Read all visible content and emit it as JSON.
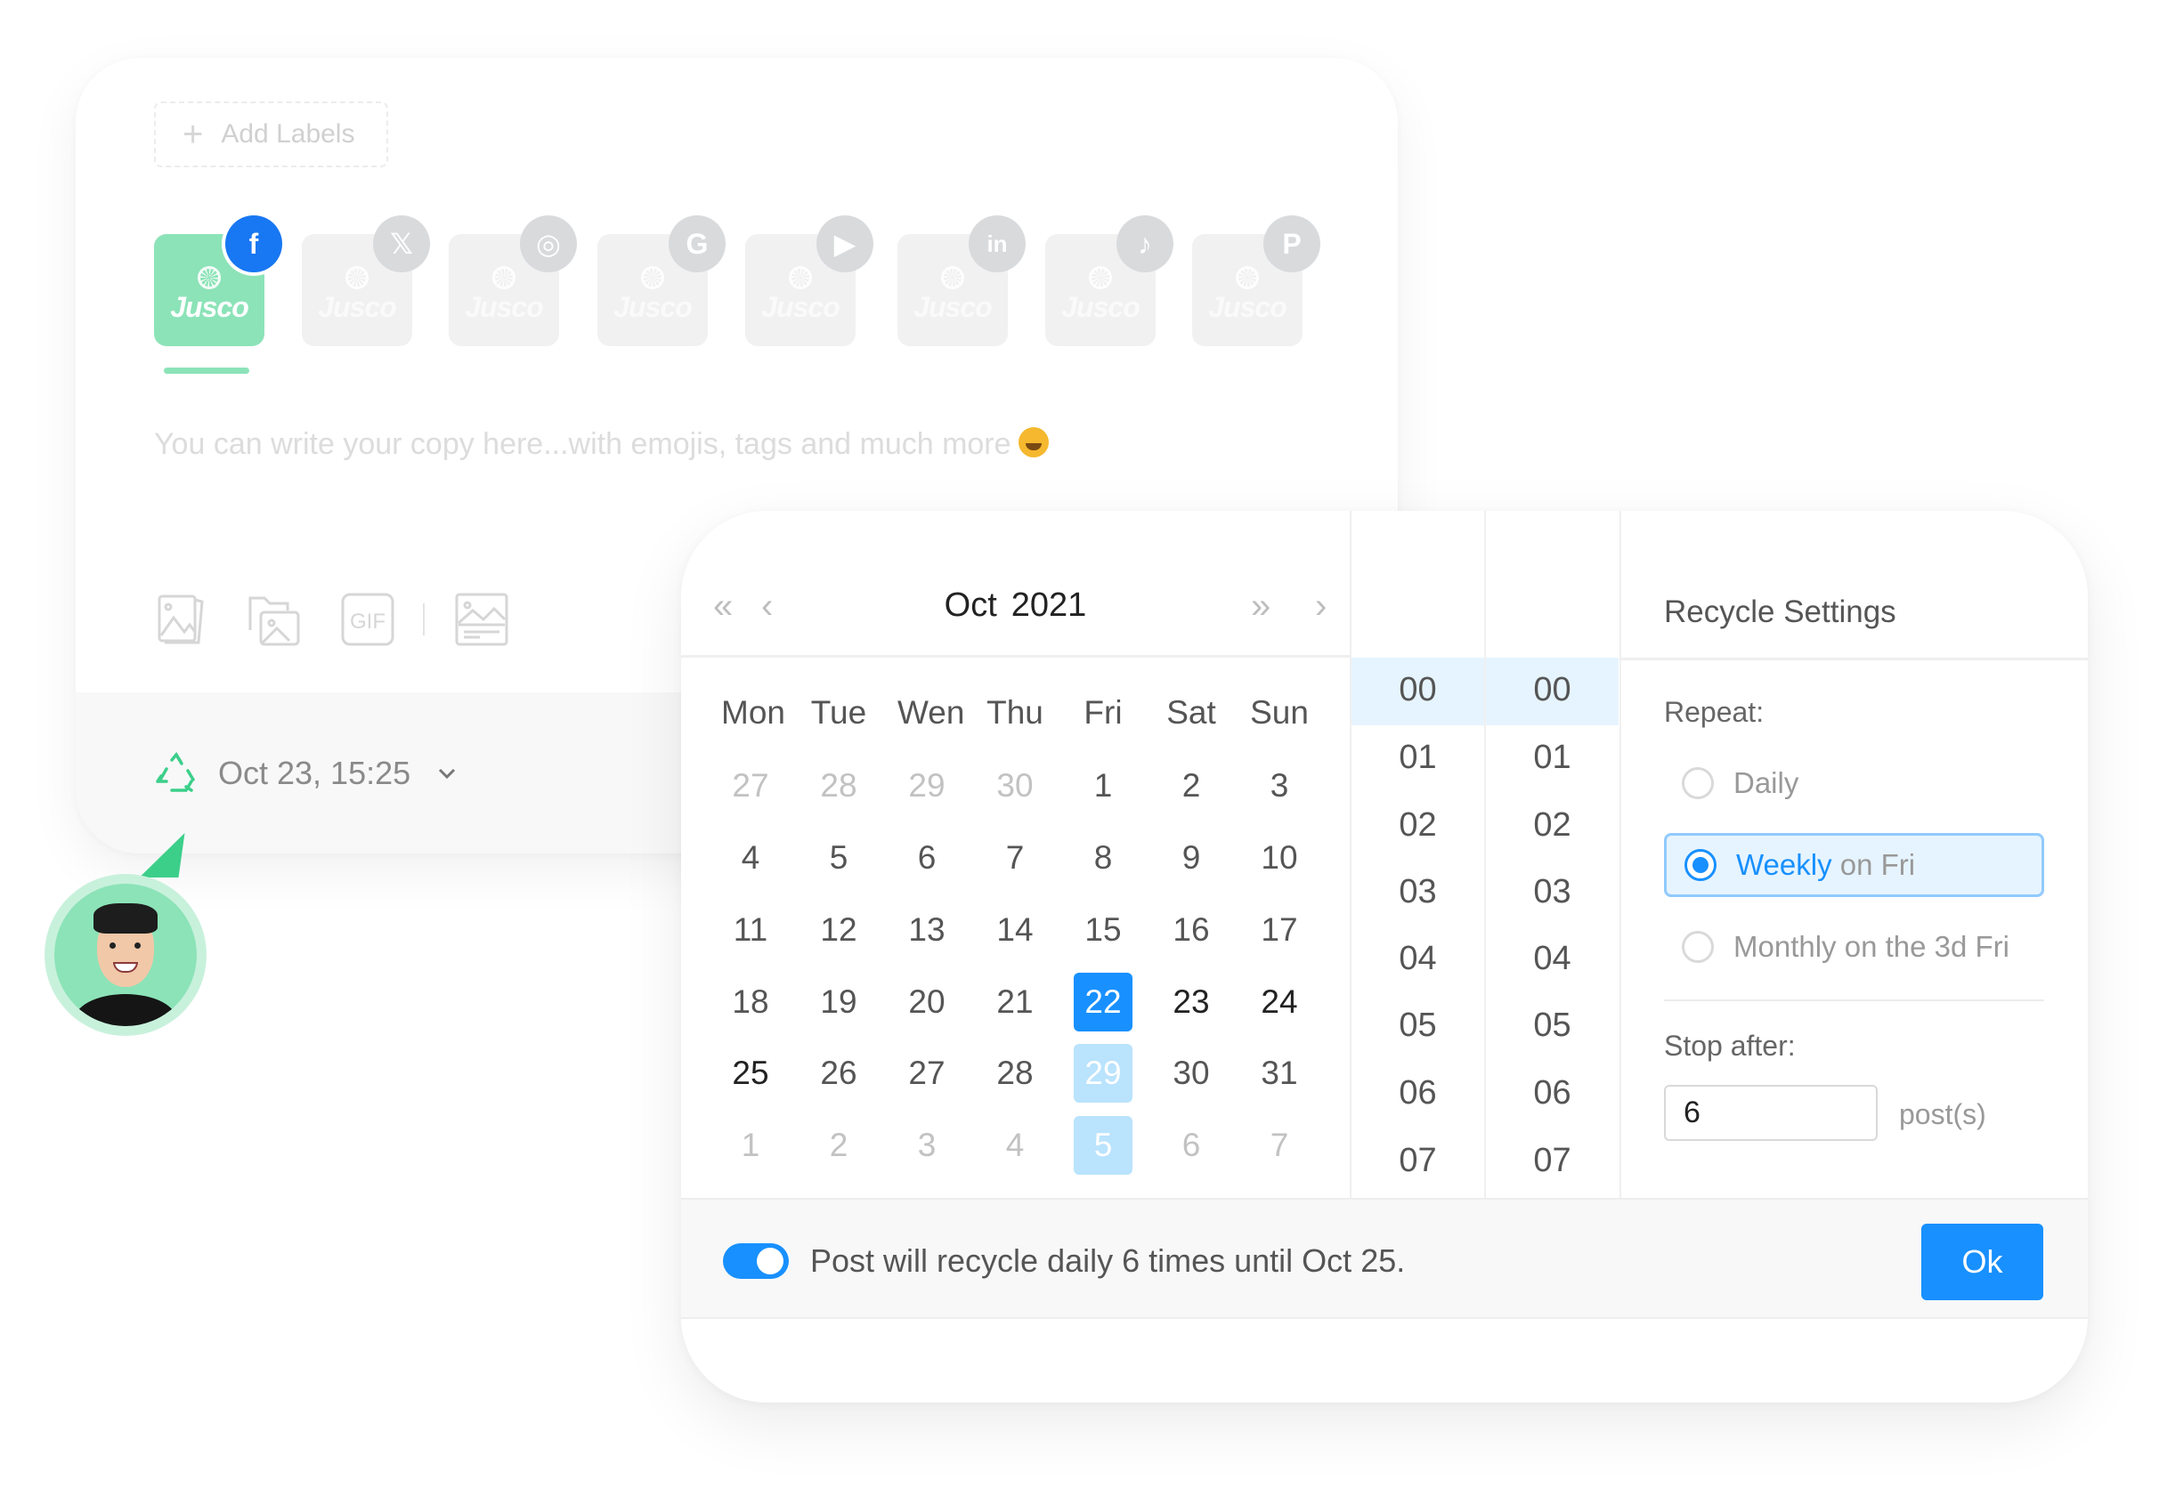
{
  "composer": {
    "add_labels": {
      "icon": "plus-icon",
      "label": "Add Labels"
    },
    "accounts": [
      {
        "name": "Jusco",
        "network": "facebook",
        "badge_icon": "facebook-icon",
        "active": true
      },
      {
        "name": "Jusco",
        "network": "x",
        "badge_icon": "x-icon",
        "active": false
      },
      {
        "name": "Jusco",
        "network": "instagram",
        "badge_icon": "instagram-icon",
        "active": false
      },
      {
        "name": "Jusco",
        "network": "google",
        "badge_icon": "google-icon",
        "active": false
      },
      {
        "name": "Jusco",
        "network": "youtube",
        "badge_icon": "youtube-icon",
        "active": false
      },
      {
        "name": "Jusco",
        "network": "linkedin",
        "badge_icon": "linkedin-icon",
        "active": false
      },
      {
        "name": "Jusco",
        "network": "tiktok",
        "badge_icon": "tiktok-icon",
        "active": false
      },
      {
        "name": "Jusco",
        "network": "pinterest",
        "badge_icon": "pinterest-icon",
        "active": false
      }
    ],
    "copy_placeholder": "You can write your copy here...with emojis, tags and much more",
    "emoji": "star-struck-emoji",
    "media_tools": [
      "image-gallery-icon",
      "folder-image-icon",
      "gif-icon",
      "banner-image-icon"
    ],
    "schedule": {
      "icon": "recycle-icon",
      "text": "Oct 23, 15:25",
      "dropdown_icon": "chevron-down-icon"
    }
  },
  "colors": {
    "brand_green": "#8ce3b8",
    "accent_green": "#3ccf8a",
    "primary_blue": "#1890ff",
    "facebook_blue": "#1877f2",
    "recur_light_blue": "#bae3fd"
  },
  "calendar": {
    "nav": {
      "prev_year": "«",
      "prev_month": "‹",
      "next_year": "»",
      "next_month": "›"
    },
    "month": "Oct",
    "year": "2021",
    "weekdays": [
      "Mon",
      "Tue",
      "Wen",
      "Thu",
      "Fri",
      "Sat",
      "Sun"
    ],
    "weeks": [
      [
        {
          "d": "27",
          "s": "muted"
        },
        {
          "d": "28",
          "s": "muted"
        },
        {
          "d": "29",
          "s": "muted"
        },
        {
          "d": "30",
          "s": "muted"
        },
        {
          "d": "1",
          "s": ""
        },
        {
          "d": "2",
          "s": ""
        },
        {
          "d": "3",
          "s": ""
        }
      ],
      [
        {
          "d": "4",
          "s": ""
        },
        {
          "d": "5",
          "s": ""
        },
        {
          "d": "6",
          "s": ""
        },
        {
          "d": "7",
          "s": ""
        },
        {
          "d": "8",
          "s": ""
        },
        {
          "d": "9",
          "s": ""
        },
        {
          "d": "10",
          "s": ""
        }
      ],
      [
        {
          "d": "11",
          "s": ""
        },
        {
          "d": "12",
          "s": ""
        },
        {
          "d": "13",
          "s": ""
        },
        {
          "d": "14",
          "s": ""
        },
        {
          "d": "15",
          "s": ""
        },
        {
          "d": "16",
          "s": ""
        },
        {
          "d": "17",
          "s": ""
        }
      ],
      [
        {
          "d": "18",
          "s": ""
        },
        {
          "d": "19",
          "s": ""
        },
        {
          "d": "20",
          "s": ""
        },
        {
          "d": "21",
          "s": ""
        },
        {
          "d": "22",
          "s": "selected"
        },
        {
          "d": "23",
          "s": "bold"
        },
        {
          "d": "24",
          "s": "bold"
        }
      ],
      [
        {
          "d": "25",
          "s": "bold"
        },
        {
          "d": "26",
          "s": ""
        },
        {
          "d": "27",
          "s": ""
        },
        {
          "d": "28",
          "s": ""
        },
        {
          "d": "29",
          "s": "recur"
        },
        {
          "d": "30",
          "s": ""
        },
        {
          "d": "31",
          "s": ""
        }
      ],
      [
        {
          "d": "1",
          "s": "muted"
        },
        {
          "d": "2",
          "s": "muted"
        },
        {
          "d": "3",
          "s": "muted"
        },
        {
          "d": "4",
          "s": "muted"
        },
        {
          "d": "5",
          "s": "recur"
        },
        {
          "d": "6",
          "s": "muted"
        },
        {
          "d": "7",
          "s": "muted"
        }
      ]
    ],
    "hours": [
      "00",
      "01",
      "02",
      "03",
      "04",
      "05",
      "06",
      "07"
    ],
    "minutes": [
      "00",
      "01",
      "02",
      "03",
      "04",
      "05",
      "06",
      "07"
    ],
    "selected_hour": "00",
    "selected_minute": "00"
  },
  "recycle_settings": {
    "title": "Recycle Settings",
    "repeat_label": "Repeat:",
    "options": [
      {
        "main": "Daily",
        "rest": "",
        "selected": false
      },
      {
        "main": "Weekly",
        "rest": " on Fri",
        "selected": true
      },
      {
        "main": "Monthly",
        "rest": " on the 3d Fri",
        "selected": false
      }
    ],
    "stop_after_label": "Stop after:",
    "stop_after_value": "6",
    "stop_after_unit": "post(s)"
  },
  "footer": {
    "toggle_on": true,
    "summary": "Post will recycle daily 6 times until Oct 25.",
    "ok_label": "Ok"
  }
}
